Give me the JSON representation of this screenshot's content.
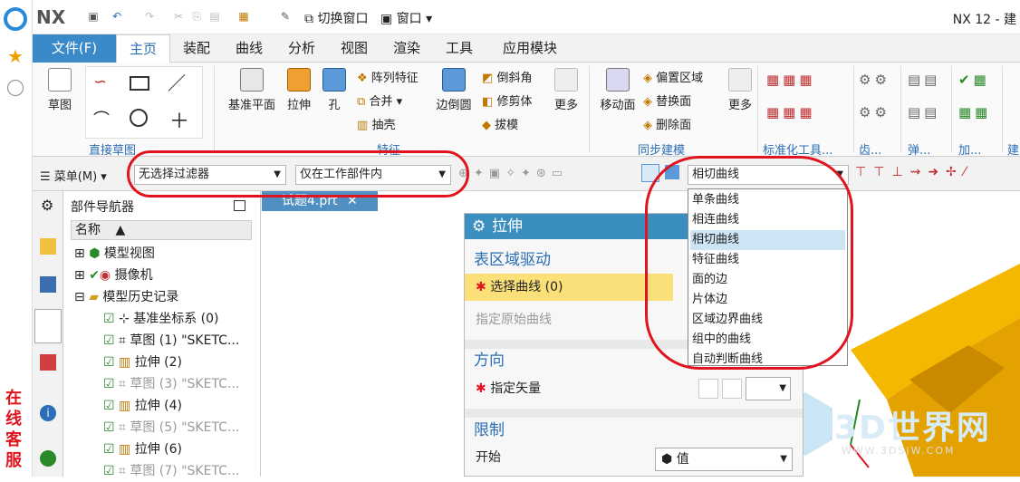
{
  "app": {
    "title": "NX 12 - 建",
    "logo": "NX"
  },
  "quickaccess": {
    "switch_window": "切换窗口",
    "window": "窗口"
  },
  "menubar": {
    "file": "文件(F)",
    "tabs": [
      "主页",
      "装配",
      "曲线",
      "分析",
      "视图",
      "渲染",
      "工具",
      "应用模块"
    ]
  },
  "ribbon": {
    "sketch": "草图",
    "group_direct_sketch": "直接草图",
    "datum_plane": "基准平面",
    "extrude": "拉伸",
    "hole": "孔",
    "array": "阵列特征",
    "union": "合并",
    "shell": "抽壳",
    "edge_blend": "边倒圆",
    "chamfer": "倒斜角",
    "trim_body": "修剪体",
    "draft": "拔模",
    "more": "更多",
    "group_feature": "特征",
    "move_face": "移动面",
    "offset_region": "偏置区域",
    "replace_face": "替换面",
    "delete_face": "删除面",
    "more2": "更多",
    "group_sync": "同步建模",
    "group_std": "标准化工具...",
    "group_gear": "齿...",
    "group_spring": "弹...",
    "group_add": "加...",
    "group_build": "建"
  },
  "toolbar2": {
    "menu": "菜单(M)",
    "filter": "无选择过滤器",
    "scope": "仅在工作部件内",
    "curve_rule": "相切曲线"
  },
  "navigator": {
    "title": "部件导航器",
    "col_name": "名称",
    "items": [
      "模型视图",
      "摄像机",
      "模型历史记录",
      "基准坐标系 (0)",
      "草图 (1) \"SKETC...",
      "拉伸 (2)",
      "草图 (3) \"SKETC...",
      "拉伸 (4)",
      "草图 (5) \"SKETC...",
      "拉伸 (6)",
      "草图 (7) \"SKETC..."
    ]
  },
  "doc_tab": "试题4.prt",
  "dialog": {
    "title": "拉伸",
    "section_region": "表区域驱动",
    "select_curve": "选择曲线 (0)",
    "specify_origin": "指定原始曲线",
    "section_direction": "方向",
    "specify_vector": "指定矢量",
    "section_limits": "限制",
    "start": "开始",
    "start_value": "值"
  },
  "dropdown": {
    "items": [
      "单条曲线",
      "相连曲线",
      "相切曲线",
      "特征曲线",
      "面的边",
      "片体边",
      "区域边界曲线",
      "组中的曲线",
      "自动判断曲线"
    ],
    "selected_index": 2
  },
  "sidebar_ad": {
    "text": "在线客服"
  },
  "watermark": {
    "brand": "3D世界网",
    "url": "WWW.3DSJW.COM"
  },
  "colors": {
    "accent": "#3a89c9",
    "model": "#f5b800",
    "annot": "#e0141e"
  }
}
